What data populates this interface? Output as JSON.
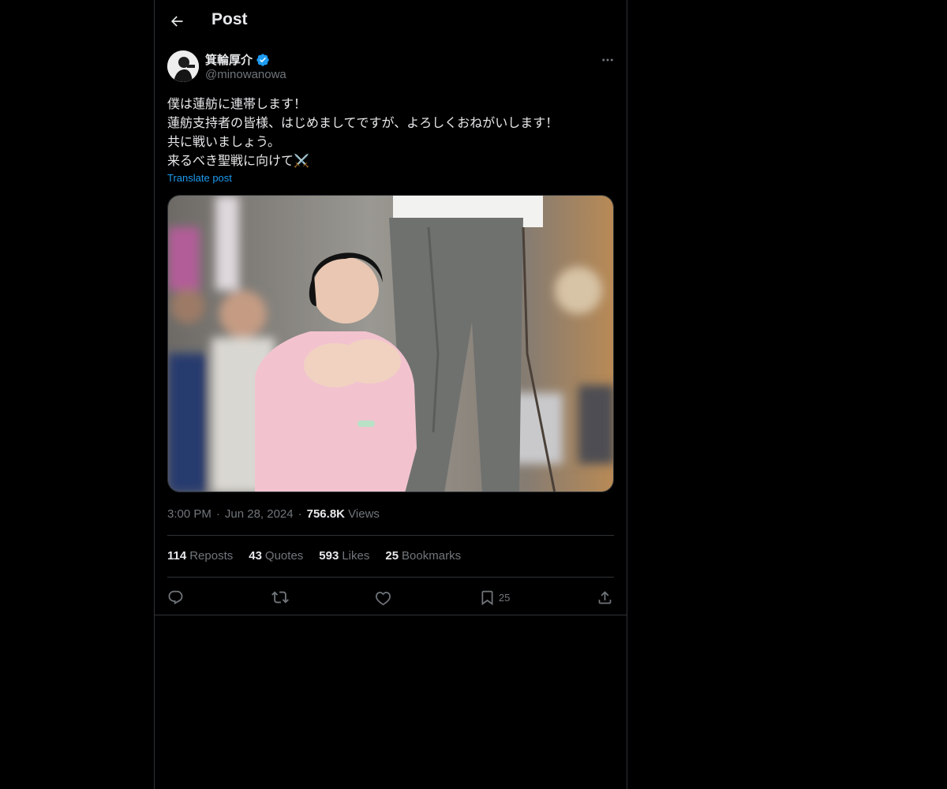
{
  "header": {
    "title": "Post"
  },
  "author": {
    "name": "箕輪厚介",
    "handle": "@minowanowa",
    "verified": true
  },
  "post": {
    "text": "僕は蓮舫に連帯します！\n蓮舫支持者の皆様、はじめましてですが、よろしくおねがいします！\n共に戦いましょう。\n来るべき聖戦に向けて⚔️",
    "translate_label": "Translate post",
    "time": "3:00 PM",
    "date": "Jun 28, 2024",
    "views_count": "756.8K",
    "views_label": "Views"
  },
  "stats": {
    "reposts_count": "114",
    "reposts_label": "Reposts",
    "quotes_count": "43",
    "quotes_label": "Quotes",
    "likes_count": "593",
    "likes_label": "Likes",
    "bookmarks_count": "25",
    "bookmarks_label": "Bookmarks"
  },
  "actions": {
    "reply_icon": "reply-icon",
    "repost_icon": "repost-icon",
    "like_icon": "heart-icon",
    "bookmark_icon": "bookmark-icon",
    "bookmark_count": "25",
    "share_icon": "share-icon"
  },
  "colors": {
    "background": "#000000",
    "text": "#e7e9ea",
    "muted": "#71767b",
    "accent": "#1d9bf0",
    "border": "#2f3336"
  }
}
